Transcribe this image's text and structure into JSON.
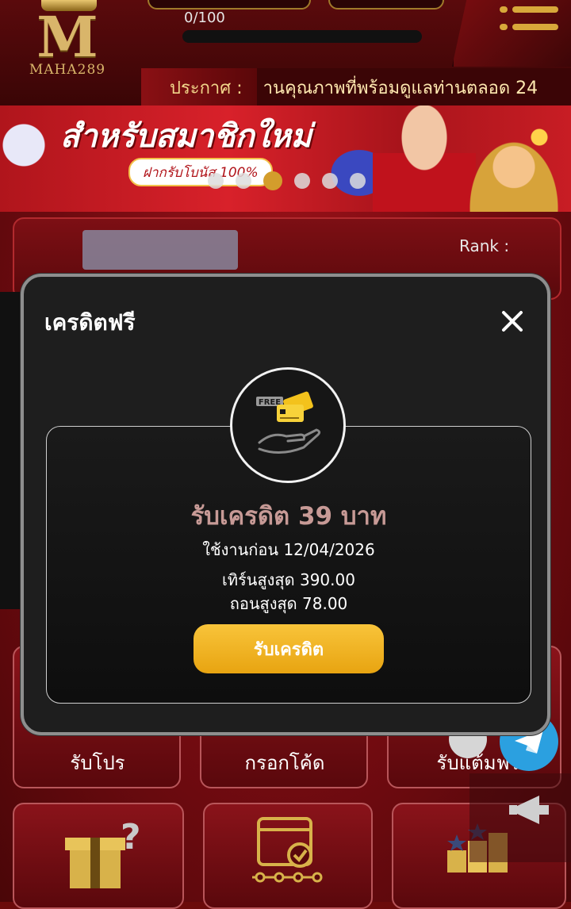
{
  "header": {
    "logo_letter": "M",
    "logo_name": "MAHA289",
    "progress": {
      "text": "0/100",
      "fraction": 0.0
    },
    "marquee": {
      "label": "ประกาศ :",
      "text": "านคุณภาพที่พร้อมดูแลท่านตลอด 24"
    }
  },
  "banner": {
    "title": "สำหรับสมาชิกใหม่",
    "subtitle": "ฝากรับโบนัส 100%",
    "slide_count": 6,
    "active_slide": 2
  },
  "profile": {
    "rank_label": "Rank :"
  },
  "tiles": {
    "promo": "รับโปร",
    "code": "กรอกโค้ด",
    "extra": "รับแต้มฟรี"
  },
  "modal": {
    "title": "เครดิตฟรี",
    "badge": "FREE",
    "credit_title": "รับเครดิต 39 บาท",
    "use_before": "ใช้งานก่อน 12/04/2026",
    "max_turn": "เทิร์นสูงสุด 390.00",
    "max_withdraw": "ถอนสูงสุด 78.00",
    "claim_button": "รับเครดิต"
  },
  "colors": {
    "accent_gold": "#f5b82a",
    "credit_text": "#c79a96",
    "telegram": "#2ba0e0"
  },
  "icons": [
    "menu-icon",
    "close-icon",
    "free-credit-hand-icon",
    "gift-question-icon",
    "calendar-check-icon",
    "ranking-icon",
    "telegram-icon",
    "megaphone-icon"
  ]
}
